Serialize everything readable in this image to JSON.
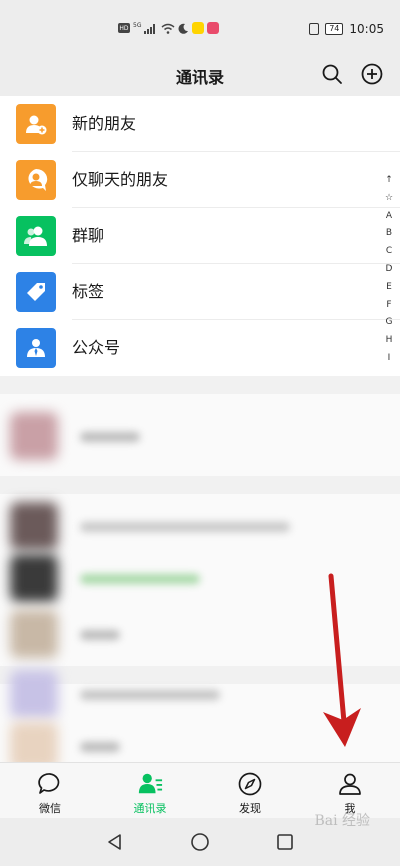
{
  "status_bar": {
    "left_labels": [
      "HD",
      "5G"
    ],
    "battery": "74",
    "time": "10:05"
  },
  "header": {
    "title": "通讯录",
    "search_icon": "search-icon",
    "add_icon": "plus-circle-icon"
  },
  "list_items": [
    {
      "label": "新的朋友",
      "icon": "add-friend-icon",
      "color": "#f79c2d"
    },
    {
      "label": "仅聊天的朋友",
      "icon": "chat-only-friend-icon",
      "color": "#f79c2d"
    },
    {
      "label": "群聊",
      "icon": "group-chat-icon",
      "color": "#07c160"
    },
    {
      "label": "标签",
      "icon": "tag-icon",
      "color": "#2d82e6"
    },
    {
      "label": "公众号",
      "icon": "official-account-icon",
      "color": "#2d82e6"
    }
  ],
  "alphabet_index": [
    "↑",
    "☆",
    "A",
    "B",
    "C",
    "D",
    "E",
    "F",
    "G",
    "H",
    "I"
  ],
  "tabs": [
    {
      "label": "微信",
      "icon": "chat-bubble-icon",
      "active": false
    },
    {
      "label": "通讯录",
      "icon": "contacts-icon",
      "active": true
    },
    {
      "label": "发现",
      "icon": "compass-icon",
      "active": false
    },
    {
      "label": "我",
      "icon": "person-icon",
      "active": false
    }
  ],
  "colors": {
    "accent": "#07c160",
    "annotation_arrow": "#c81e1e"
  },
  "watermark": "Bai 经验"
}
